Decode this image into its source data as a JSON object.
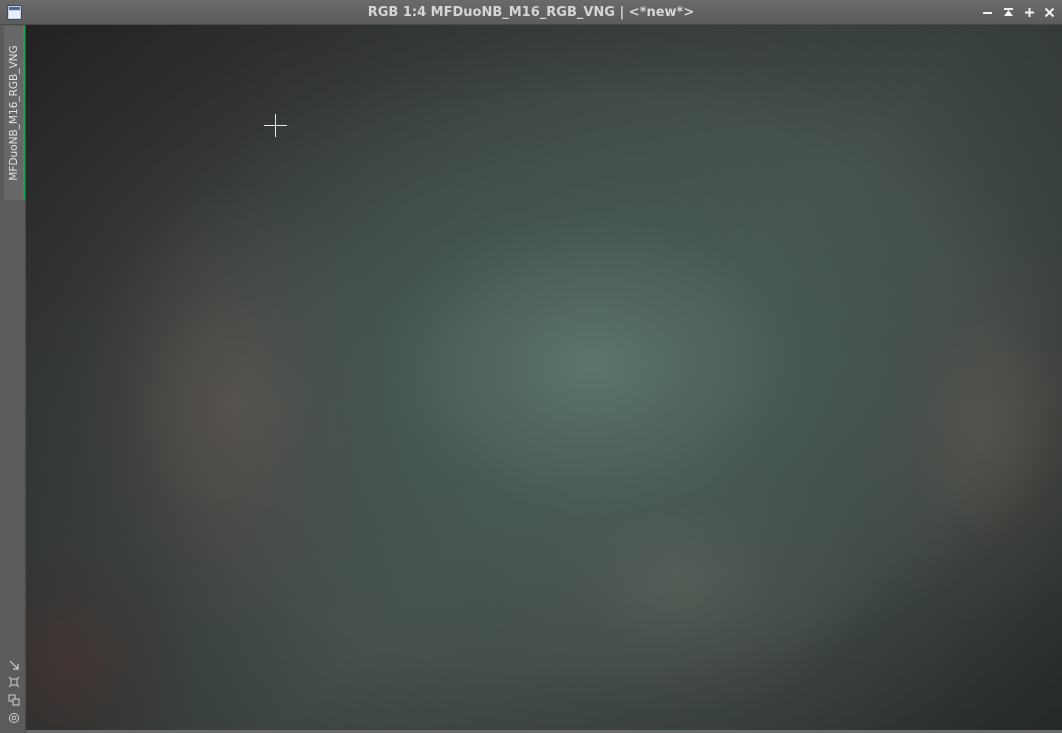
{
  "window": {
    "title": "RGB 1:4 MFDuoNB_M16_RGB_VNG | <*new*>",
    "icon": "window-icon",
    "controls": [
      "minimize-icon",
      "shade-icon",
      "maximize-icon",
      "close-icon"
    ]
  },
  "sidebar": {
    "tab_label": "MFDuoNB_M16_RGB_VNG",
    "tab_accent": "#1fa055",
    "tools": [
      "fit-window-icon",
      "zoom-to-fit-icon",
      "clone-view-icon",
      "target-icon"
    ]
  },
  "image": {
    "cursor": "crosshair-icon"
  }
}
